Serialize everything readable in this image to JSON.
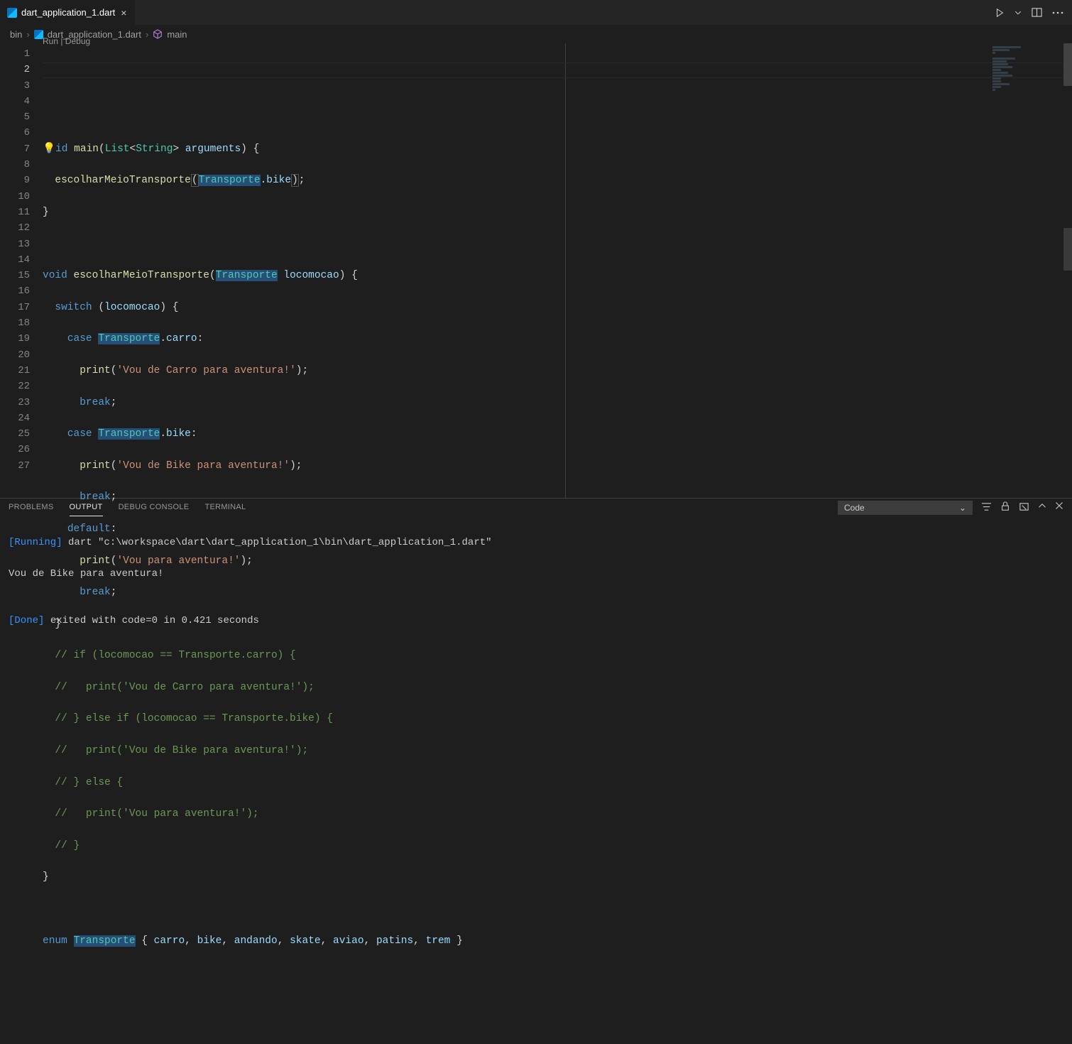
{
  "tab": {
    "title": "dart_application_1.dart"
  },
  "breadcrumbs": [
    "bin",
    "dart_application_1.dart",
    "main"
  ],
  "codelens": "Run | Debug",
  "line_numbers": [
    "1",
    "2",
    "3",
    "4",
    "5",
    "6",
    "7",
    "8",
    "9",
    "10",
    "11",
    "12",
    "13",
    "14",
    "15",
    "16",
    "17",
    "18",
    "19",
    "20",
    "21",
    "22",
    "23",
    "24",
    "25",
    "26",
    "27"
  ],
  "code": {
    "l1": {
      "kw_void": "void",
      "fn_main": "main",
      "p1": "(",
      "ty_list": "List",
      "lt": "<",
      "ty_str": "String",
      "gt": ">",
      "sp": " ",
      "va_args": "arguments",
      "p2": ")",
      "sp2": " ",
      "br": "{"
    },
    "l2": {
      "fn": "escolharMeioTransporte",
      "p1": "(",
      "ty": "Transporte",
      "dot": ".",
      "va": "bike",
      "p2": ")",
      "semi": ";"
    },
    "l3": {
      "br": "}"
    },
    "l5": {
      "kw": "void",
      "fn": "escolharMeioTransporte",
      "p1": "(",
      "ty": "Transporte",
      "va": "locomocao",
      "p2": ")",
      "br": "{"
    },
    "l6": {
      "kw": "switch",
      "p1": "(",
      "va": "locomocao",
      "p2": ")",
      "br": "{"
    },
    "l7": {
      "kw": "case",
      "ty": "Transporte",
      "dot": ".",
      "va": "carro",
      "col": ":"
    },
    "l8": {
      "fn": "print",
      "p1": "(",
      "str": "'Vou de Carro para aventura!'",
      "p2": ")",
      "semi": ";"
    },
    "l9": {
      "kw": "break",
      "semi": ";"
    },
    "l10": {
      "kw": "case",
      "ty": "Transporte",
      "dot": ".",
      "va": "bike",
      "col": ":"
    },
    "l11": {
      "fn": "print",
      "p1": "(",
      "str": "'Vou de Bike para aventura!'",
      "p2": ")",
      "semi": ";"
    },
    "l12": {
      "kw": "break",
      "semi": ";"
    },
    "l13": {
      "kw": "default",
      "col": ":"
    },
    "l14": {
      "fn": "print",
      "p1": "(",
      "str": "'Vou para aventura!'",
      "p2": ")",
      "semi": ";"
    },
    "l15": {
      "kw": "break",
      "semi": ";"
    },
    "l16": {
      "br": "}"
    },
    "l17": "  // if (locomocao == Transporte.carro) {",
    "l18": "  //   print('Vou de Carro para aventura!');",
    "l19": "  // } else if (locomocao == Transporte.bike) {",
    "l20": "  //   print('Vou de Bike para aventura!');",
    "l21": "  // } else {",
    "l22": "  //   print('Vou para aventura!');",
    "l23": "  // }",
    "l24": {
      "br": "}"
    },
    "l26": {
      "kw": "enum",
      "ty": "Transporte",
      "br1": "{",
      "v1": "carro",
      "v2": "bike",
      "v3": "andando",
      "v4": "skate",
      "v5": "aviao",
      "v6": "patins",
      "v7": "trem",
      "br2": "}"
    }
  },
  "panel": {
    "tabs": [
      "PROBLEMS",
      "OUTPUT",
      "DEBUG CONSOLE",
      "TERMINAL"
    ],
    "dropdown": "Code",
    "lines": {
      "l1": {
        "tag": "[Running]",
        "txt": " dart \"c:\\workspace\\dart\\dart_application_1\\bin\\dart_application_1.dart\""
      },
      "l2": "Vou de Bike para aventura!",
      "l3": "",
      "l4": {
        "tag": "[Done]",
        "txt": " exited with code=0 in 0.421 seconds"
      }
    }
  }
}
